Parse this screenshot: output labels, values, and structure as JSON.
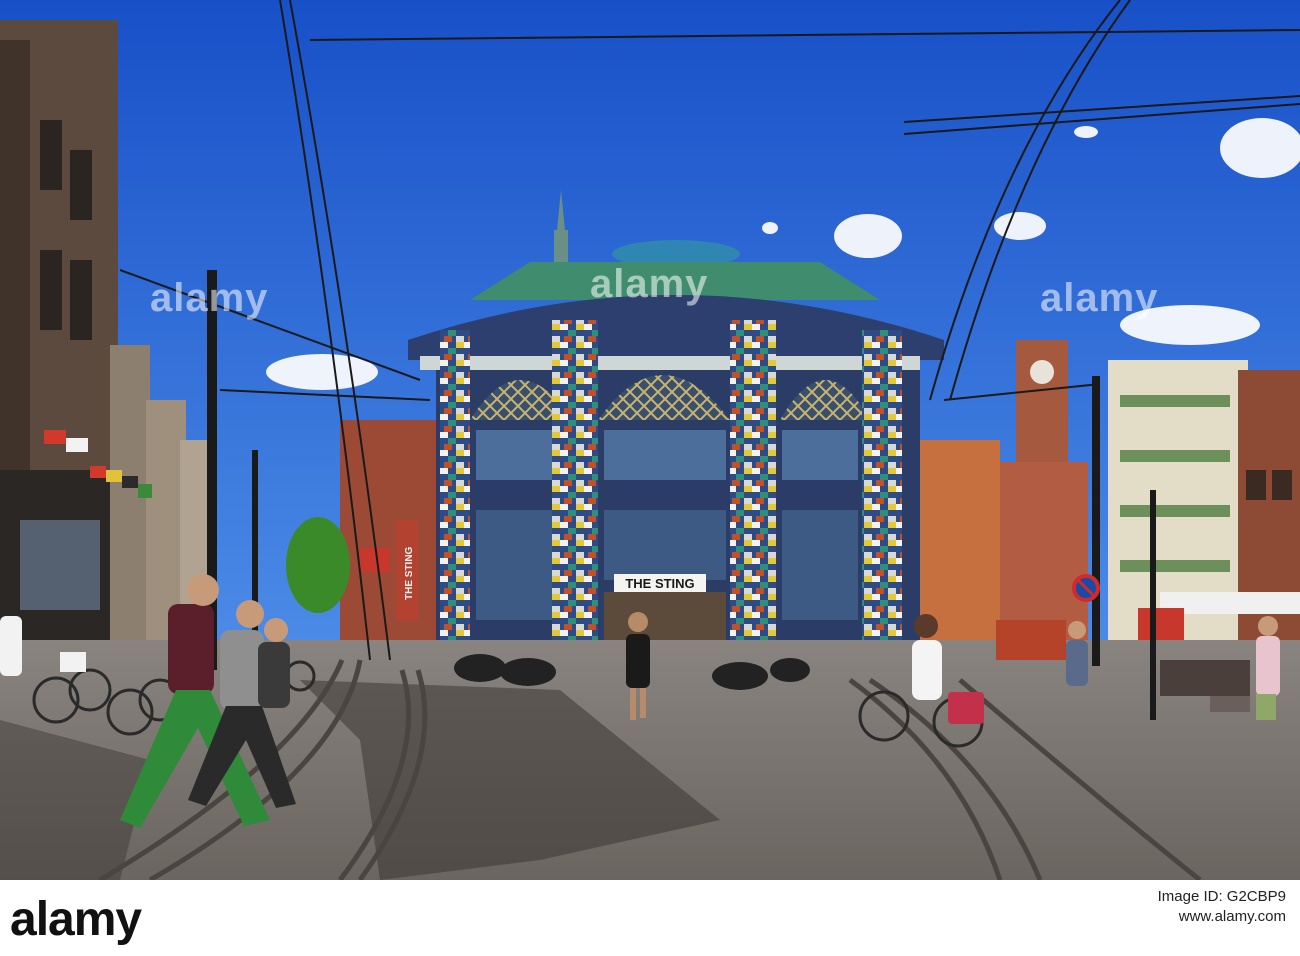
{
  "photo": {
    "sign_text": "THE STING",
    "side_sign_text": "THE STING",
    "watermarks": [
      "alamy",
      "alamy",
      "alamy"
    ]
  },
  "footer": {
    "brand": "alamy",
    "image_id": "Image ID: G2CBP9",
    "url": "www.alamy.com"
  }
}
